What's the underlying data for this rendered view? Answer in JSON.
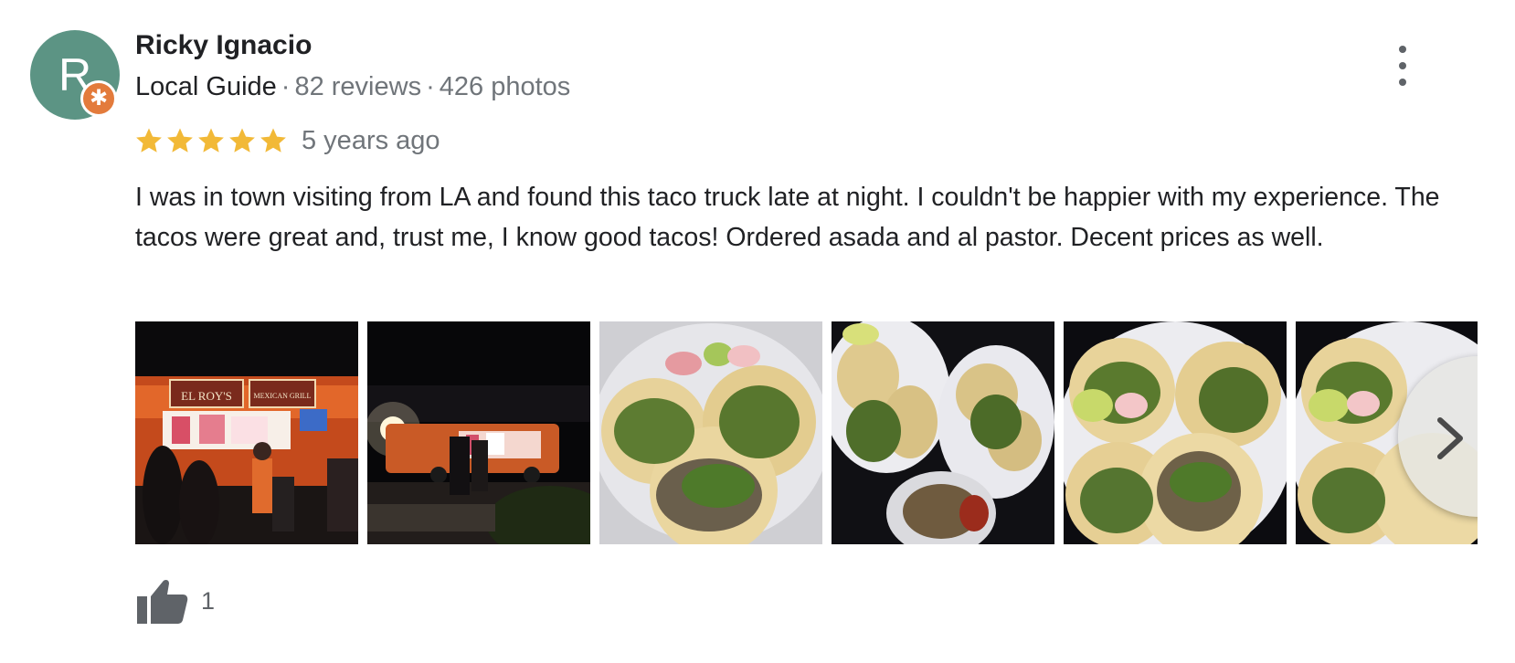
{
  "reviewer": {
    "name": "Ricky Ignacio",
    "avatar_letter": "R",
    "badge_symbol": "✱",
    "level": "Local Guide",
    "reviews": "82 reviews",
    "photos": "426 photos",
    "separator": "·",
    "avatar_color": "#5c9484",
    "badge_color": "#e37b3c"
  },
  "review": {
    "rating": 5,
    "max_rating": 5,
    "date": "5 years ago",
    "text": "I was in town visiting from LA and found this taco truck late at night. I couldn't be happier with my experience. The tacos were great and, trust me, I know good tacos! Ordered asada and al pastor. Decent prices as well.",
    "star_color": "#f2b937"
  },
  "photos": {
    "count_visible": 6,
    "truck_sign": "EL ROY'S",
    "truck_sign_2": "MEXICAN GRILL"
  },
  "actions": {
    "more_icon": "more-vert-icon",
    "next_icon": "chevron-right-icon",
    "like_icon": "thumb-up-icon",
    "like_count": "1"
  }
}
